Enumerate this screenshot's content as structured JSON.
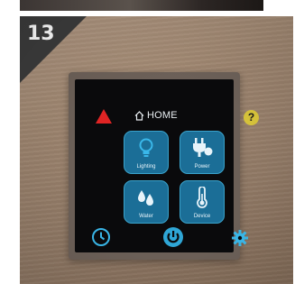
{
  "step": {
    "number": "13"
  },
  "panel": {
    "header": {
      "title": "HOME",
      "home_icon": "home-icon"
    },
    "warning_icon": "warning-triangle-icon",
    "help": {
      "icon": "help-icon",
      "symbol": "?"
    },
    "tiles": [
      {
        "label": "Lighting",
        "icon": "bulb-icon"
      },
      {
        "label": "Power",
        "icon": "plug-icon"
      },
      {
        "label": "Water",
        "icon": "water-drops-icon"
      },
      {
        "label": "Device",
        "icon": "thermometer-icon"
      }
    ],
    "bottom_bar": {
      "clock_icon": "clock-icon",
      "power_icon": "power-icon",
      "settings_icon": "gear-icon"
    },
    "colors": {
      "accent": "#1b6e97",
      "icon": "#3ab8ea",
      "warning": "#e02424",
      "help": "#d6c23a",
      "screen": "#0a0a0c"
    }
  }
}
